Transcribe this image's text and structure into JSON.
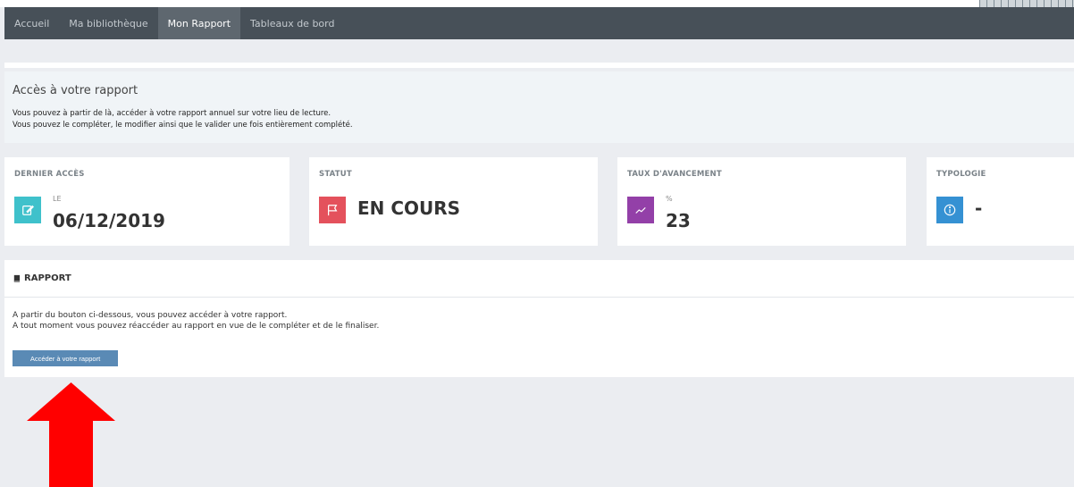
{
  "nav": {
    "items": [
      {
        "label": "Accueil"
      },
      {
        "label": "Ma bibliothèque"
      },
      {
        "label": "Mon Rapport"
      },
      {
        "label": "Tableaux de bord"
      }
    ],
    "active_index": 2
  },
  "intro": {
    "title": "Accès à votre rapport",
    "lines": [
      "Vous pouvez à partir de là, accéder à votre rapport annuel sur votre lieu de lecture.",
      "Vous pouvez le compléter, le modifier ainsi que le valider une fois entièrement complété."
    ]
  },
  "cards": [
    {
      "title": "DERNIER ACCÈS",
      "small": "LE",
      "value": "06/12/2019",
      "icon": "edit-icon",
      "color": "#3fc1cb"
    },
    {
      "title": "STATUT",
      "small": "",
      "value": "EN COURS",
      "icon": "flag-icon",
      "color": "#e4515c"
    },
    {
      "title": "TAUX D'AVANCEMENT",
      "small": "%",
      "value": "23",
      "icon": "trend-icon",
      "color": "#9340a8"
    },
    {
      "title": "TYPOLOGIE",
      "small": "",
      "value": "-",
      "icon": "info-icon",
      "color": "#3591d3"
    }
  ],
  "rapport": {
    "heading": "RAPPORT",
    "lines": [
      "A partir du bouton ci-dessous, vous pouvez accéder à votre rapport.",
      "A tout moment vous pouvez réaccéder au rapport en vue de le compléter et de le finaliser."
    ],
    "button_label": "Accéder à votre rapport"
  },
  "colors": {
    "navbar": "#475058",
    "arrow": "#ff0000",
    "button": "#5a8ab5"
  }
}
